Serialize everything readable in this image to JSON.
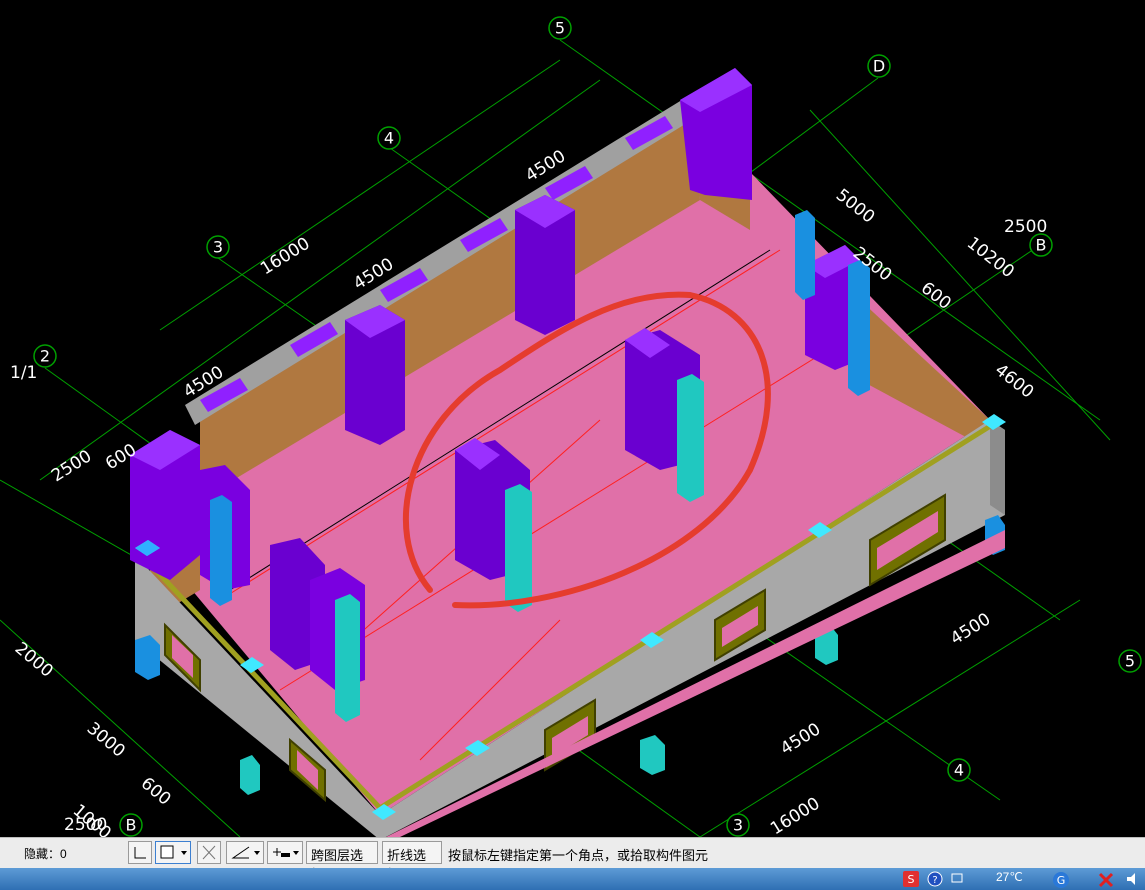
{
  "viewport": {
    "grid_bubbles": {
      "top_axis_5": "5",
      "top_axis_4": "4",
      "top_axis_3": "3",
      "top_axis_2": "2",
      "right_axis_D": "D",
      "right_axis_B": "B",
      "bottom_axis_B": "B",
      "bottom_axis_3": "3",
      "bottom_axis_4": "4",
      "bottom_axis_5": "5"
    },
    "left_axis_label": "1/1",
    "dims_top": [
      "4500",
      "16000",
      "4500",
      "4500"
    ],
    "dims_right": [
      "5000",
      "2500",
      "2500",
      "10200",
      "600",
      "4600"
    ],
    "dims_left": [
      "2500",
      "600",
      "2000",
      "3000",
      "600",
      "2500",
      "1000"
    ],
    "dims_bottom": [
      "4500",
      "4500",
      "16000"
    ],
    "colors": {
      "floor": "#e070a8",
      "wall_gray": "#a8a8a8",
      "wall_brown": "#b07840",
      "column_purple": "#7a00e0",
      "column_cyan": "#20c8c0",
      "grid_green": "#00a000",
      "annotation_red": "#e53c2e"
    }
  },
  "statusbar": {
    "hidden_label": "隐藏：0",
    "cross_layer_select": "跨图层选择",
    "polyline_select": "折线选择",
    "prompt": "按鼠标左键指定第一个角点，或拾取构件图元"
  },
  "taskbar": {
    "temperature": "27℃"
  }
}
